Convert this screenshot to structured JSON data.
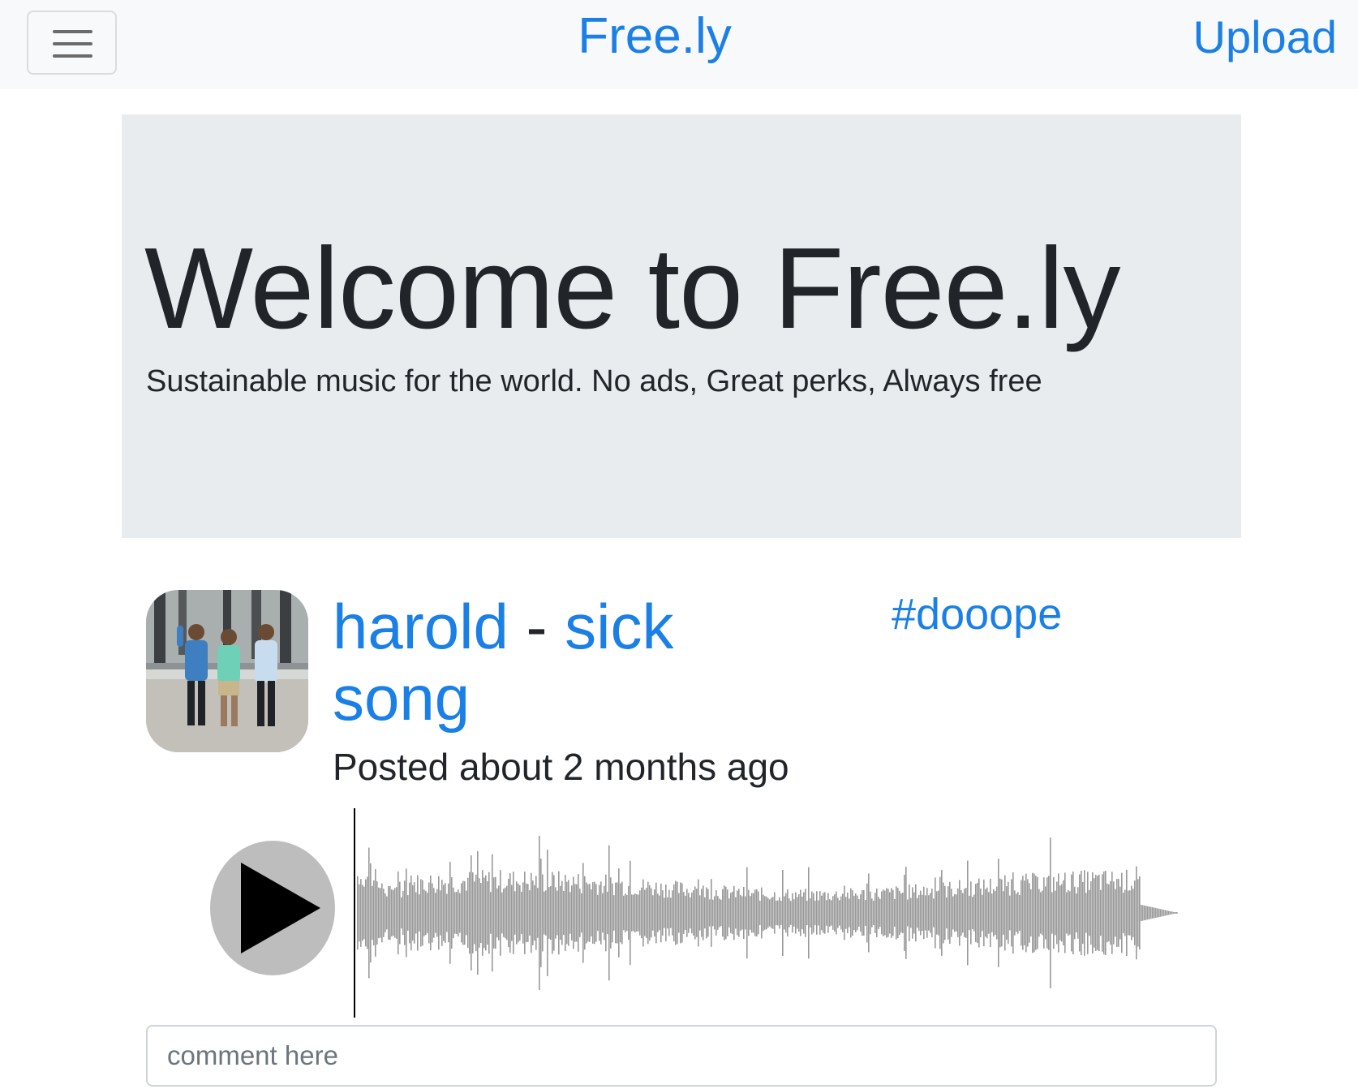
{
  "navbar": {
    "toggler_icon": "hamburger-menu-icon",
    "brand": "Free.ly",
    "upload_label": "Upload",
    "link_color": "#1a7fe6",
    "background": "#f8f9fa"
  },
  "jumbotron": {
    "title": "Welcome to Free.ly",
    "lead": "Sustainable music for the world. No ads, Great perks, Always free",
    "background": "#e9ecef"
  },
  "song": {
    "artist": "harold",
    "separator": "-",
    "title": "sick song",
    "hashtag": "#dooope",
    "posted": "Posted about 2 months ago",
    "avatar_icon": "group-photo-avatar",
    "player": {
      "play_icon": "play-icon",
      "waveform_icon": "audio-waveform",
      "waveform_color": "#999999"
    }
  },
  "comment": {
    "placeholder": "comment here",
    "value": ""
  }
}
